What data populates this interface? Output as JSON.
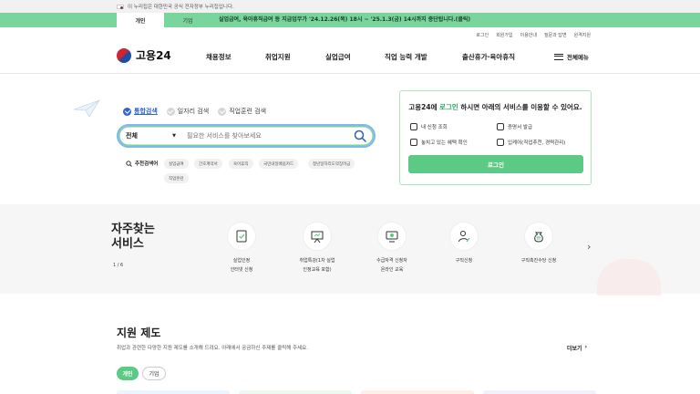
{
  "gov_banner": {
    "text": "이 누리집은 대한민국 공식 전자정부 누리집입니다."
  },
  "notice": {
    "tabs": [
      {
        "label": "개인"
      },
      {
        "label": "기업"
      }
    ],
    "message": "실업급여, 육아휴직급여 등 지급업무가 '24.12.26(목) 18시 ~ '25.1.3(금) 14시까지 중단됩니다.(클릭)"
  },
  "util_links": [
    "로그인",
    "회원가입",
    "이용안내",
    "질문과 답변",
    "원격지원"
  ],
  "logo": {
    "text": "고용24"
  },
  "gnb": {
    "items": [
      "채용정보",
      "취업지원",
      "실업급여",
      "직업 능력 개발",
      "출산휴가·육아휴직"
    ],
    "menu_all": "전체메뉴"
  },
  "search": {
    "tabs": [
      "통합검색",
      "일자리 검색",
      "직업훈련 검색"
    ],
    "select_value": "전체",
    "placeholder": "필요한 서비스를 찾아보세요"
  },
  "recommend": {
    "label": "추천검색어",
    "chips": [
      "실업급여",
      "간호계약서",
      "육아휴직",
      "국민내일배움카드",
      "청년일자리도약장려금",
      "직업훈련"
    ]
  },
  "login_box": {
    "title_pre": "고용24에 ",
    "title_hl": "로그인",
    "title_post": " 하시면 아래의 서비스를 이용할 수 있어요.",
    "services": [
      "내 신청 조회",
      "증명서 발급",
      "놓치고 있는 혜택 확인",
      "입케어(직업추천, 경력관리)"
    ],
    "button": "로그인"
  },
  "frequent": {
    "title_line1": "자주찾는",
    "title_line2": "서비스",
    "page": "1 / 6",
    "items": [
      {
        "line1": "실업인정",
        "line2": "인터넷 신청"
      },
      {
        "line1": "취업특강(1차 실업",
        "line2": "인정교육 포함)"
      },
      {
        "line1": "수급자격 신청자",
        "line2": "온라인 교육"
      },
      {
        "line1": "구직신청",
        "line2": ""
      },
      {
        "line1": "구직촉진수당 신청",
        "line2": ""
      }
    ]
  },
  "support": {
    "title": "지원 제도",
    "desc": "취업과 관련한 다양한 지원 제도를 소개해 드려요. 아래에서 궁금하신 주제를 클릭해 주세요.",
    "more": "더보기",
    "tabs": [
      "개인",
      "기업"
    ]
  },
  "colors": {
    "accent": "#5cc985",
    "notice_bg": "#79d59b",
    "search_active": "#3466c9",
    "login_highlight": "#2fa35f"
  }
}
